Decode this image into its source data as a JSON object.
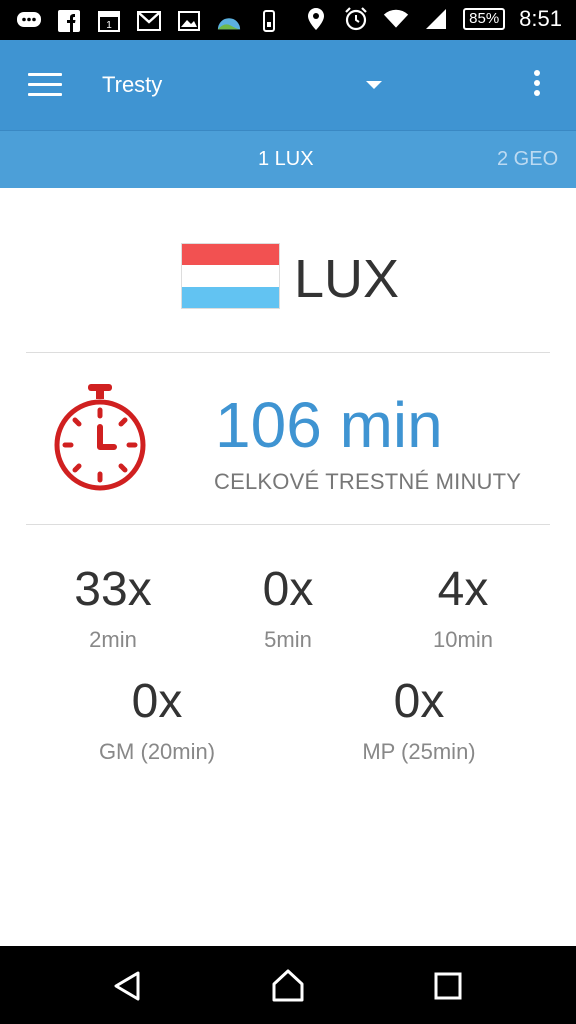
{
  "status_bar": {
    "time": "8:51",
    "battery": "85%",
    "icons": [
      "messaging-icon",
      "facebook-icon",
      "calendar-icon",
      "gmail-icon",
      "gallery-icon",
      "weather-icon",
      "phone-icon",
      "location-icon",
      "alarm-icon",
      "wifi-icon",
      "signal-icon"
    ]
  },
  "app_bar": {
    "title": "Tresty"
  },
  "tabs": [
    {
      "label": "1 LUX",
      "active": true
    },
    {
      "label": "2 GEO",
      "active": false
    }
  ],
  "country": {
    "code": "LUX",
    "flag_colors": [
      "#f25151",
      "#ffffff",
      "#62c3f2"
    ]
  },
  "total": {
    "value": "106 min",
    "label": "CELKOVÉ TRESTNÉ MINUTY"
  },
  "stats": [
    {
      "count": "33x",
      "label": "2min"
    },
    {
      "count": "0x",
      "label": "5min"
    },
    {
      "count": "4x",
      "label": "10min"
    },
    {
      "count": "0x",
      "label": "GM (20min)"
    },
    {
      "count": "0x",
      "label": "MP (25min)"
    }
  ],
  "colors": {
    "accent": "#3f94d2",
    "tab_bar": "#4c9fd8",
    "timer_icon": "#d02020"
  }
}
